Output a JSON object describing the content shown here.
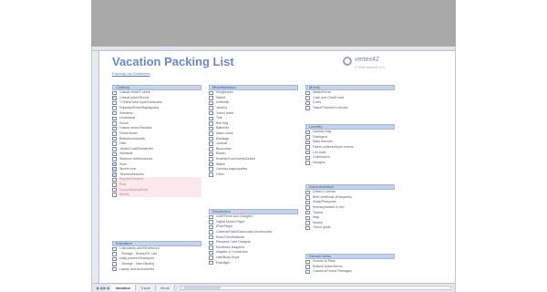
{
  "workbook": {
    "title": "Vacation Packing List",
    "subtitle": "Packing List Guidelines",
    "logo_text": "vertex42",
    "logo_sub": "© 2009 Vertex42 LLC"
  },
  "sections": {
    "clothing": {
      "header": "Clothing",
      "items": [
        "Casual shirts/T-shirts",
        "Casual pants/Shorts",
        "T-Shirts/Tank tops/Camisoles",
        "Pajamas/Robe/Nightgowns",
        "Sweaters",
        "Underwear",
        "Socks",
        "Casual shoes/Sandals",
        "Dress shoes",
        "Belts/Accessories",
        "Hats",
        "Jacket/Coat/Sweatshirt",
        "Swimsuit",
        "Workout clothes/shoes",
        "Suits",
        "Sports coat",
        "Ties/Accessories",
        "Slacks/Trousers",
        "Bras",
        "Socks/Nylons/Hose",
        "Slacks"
      ]
    },
    "miscellaneous": {
      "header": "Miscellaneous",
      "items": [
        "Sunglasses",
        "Wallet",
        "Umbrella",
        "Jewelry",
        "Travel locks",
        "Tote",
        "Belt bag",
        "Batteries",
        "Alarm clock",
        "Earplugs",
        "Journal",
        "Binoculars",
        "Books",
        "Snacks/Gum/Candy/Drinks",
        "Watch",
        "Laundry bag/supplies",
        "Other"
      ]
    },
    "money": {
      "header": "Money",
      "items": [
        "Wallet/Purse",
        "Cash and Credit card",
        "Coins",
        "Travel/Traveler's checks"
      ]
    },
    "laundry": {
      "header": "Laundry",
      "items": [
        "Laundry bag",
        "Detergent",
        "Stain remover",
        "Fabric softener/dryer sheets",
        "Lint roller",
        "Clothespins",
        "Hangers"
      ]
    },
    "documentation": {
      "header": "Documentation",
      "items": [
        "Driver's License",
        "Birth certificate (Passports)",
        "Visas/Passports",
        "Itinerary/tickets & Info",
        "Tickets",
        "Map",
        "Money",
        "Travel guide"
      ]
    },
    "electronics": {
      "header": "Electronics",
      "items": [
        "Cell/Phone and Chargers",
        "Digital Music Player",
        "iPod/Player",
        "Camera/Flash/Camcorder Accessories",
        "Extra Film/Batteries",
        "Personal Care Gadgets",
        "Electronic Adapters",
        "Adapter & Converters",
        "Hair/Body Dryer",
        "Flashlight"
      ]
    },
    "education": {
      "header": "Education",
      "items": [
        "Calculators and Electronics",
        "- Storage - Books/Flt. Use",
        "Daily planner/Scheduler",
        "- Storage - Misc Binding",
        "Laptop and Accessories"
      ]
    },
    "kitchen": {
      "header": "Kitchen Items",
      "items": [
        "Snacks to Pass",
        "Bottled Water/Drinks",
        "Crackers/Cereal Packages"
      ]
    }
  },
  "tabs": {
    "nav": "◀ ◀ ▶ ▶",
    "items": [
      "Vacation",
      "Travel",
      "Ideas"
    ]
  }
}
